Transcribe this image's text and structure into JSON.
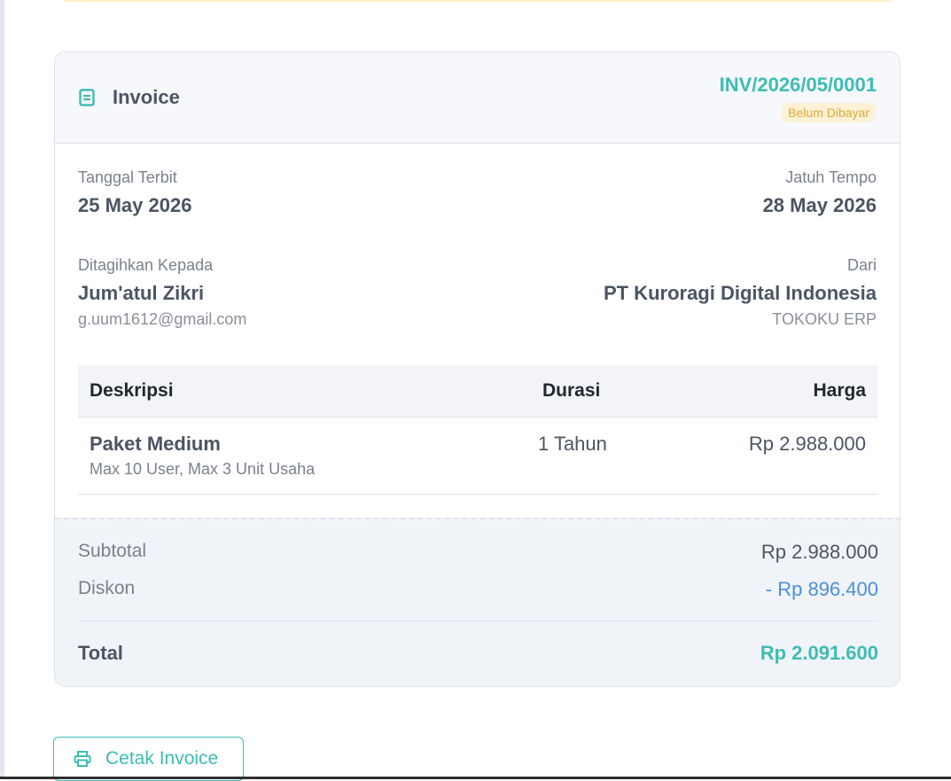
{
  "invoice": {
    "title": "Invoice",
    "number": "INV/2026/05/0001",
    "status": "Belum Dibayar",
    "issue_date_label": "Tanggal Terbit",
    "issue_date": "25 May 2026",
    "due_date_label": "Jatuh Tempo",
    "due_date": "28 May 2026",
    "billed_to_label": "Ditagihkan Kepada",
    "billed_to_name": "Jum'atul Zikri",
    "billed_to_email": "g.uum1612@gmail.com",
    "from_label": "Dari",
    "from_name": "PT Kuroragi Digital Indonesia",
    "from_sub": "TOKOKU ERP"
  },
  "table": {
    "headers": [
      "Deskripsi",
      "Durasi",
      "Harga"
    ],
    "rows": [
      {
        "name": "Paket Medium",
        "detail": "Max 10 User, Max 3 Unit Usaha",
        "duration": "1 Tahun",
        "price": "Rp 2.988.000"
      }
    ]
  },
  "summary": {
    "subtotal_label": "Subtotal",
    "subtotal_value": "Rp 2.988.000",
    "discount_label": "Diskon",
    "discount_value": "- Rp 896.400",
    "total_label": "Total",
    "total_value": "Rp 2.091.600"
  },
  "actions": {
    "print_label": "Cetak Invoice"
  },
  "icons": {
    "title": "document-icon",
    "print": "printer-icon"
  },
  "colors": {
    "accent": "#3ebcb4",
    "discount": "#4a90d9",
    "status_bg": "#fdf1d6",
    "status_fg": "#e0a93a"
  }
}
